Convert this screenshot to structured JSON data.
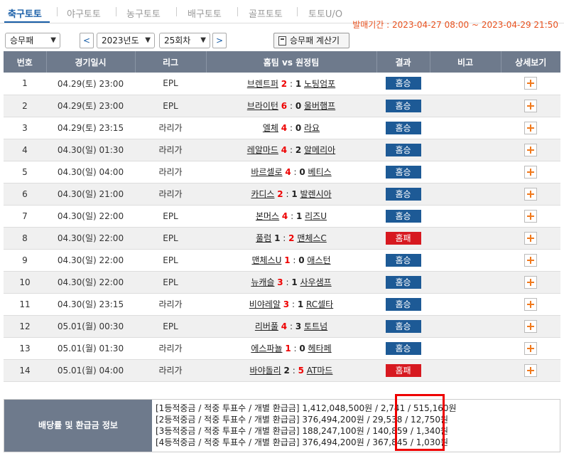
{
  "tabs": [
    "축구토토",
    "야구토토",
    "농구토토",
    "배구토토",
    "골프토토",
    "토토U/O"
  ],
  "sale_period": "발매기간 : 2023-04-27 08:00 ~ 2023-04-29 21:50",
  "controls": {
    "game_type": "승무패",
    "year": "2023년도",
    "round": "25회차",
    "prev": "<",
    "next": ">",
    "calc_label": "승무패 계산기"
  },
  "columns": [
    "번호",
    "경기일시",
    "리그",
    "홈팀 vs 원정팀",
    "결과",
    "비고",
    "상세보기"
  ],
  "rows": [
    {
      "no": "1",
      "date": "04.29(토) 23:00",
      "league": "EPL",
      "home": "브렌트퍼",
      "hs": "2",
      "as": "1",
      "away": "노팅엄포",
      "result": "홈승",
      "rtype": "home"
    },
    {
      "no": "2",
      "date": "04.29(토) 23:00",
      "league": "EPL",
      "home": "브라이턴",
      "hs": "6",
      "as": "0",
      "away": "울버햄프",
      "result": "홈승",
      "rtype": "home"
    },
    {
      "no": "3",
      "date": "04.29(토) 23:15",
      "league": "라리가",
      "home": "엘체",
      "hs": "4",
      "as": "0",
      "away": "라요",
      "result": "홈승",
      "rtype": "home"
    },
    {
      "no": "4",
      "date": "04.30(일) 01:30",
      "league": "라리가",
      "home": "레알마드",
      "hs": "4",
      "as": "2",
      "away": "알메리아",
      "result": "홈승",
      "rtype": "home"
    },
    {
      "no": "5",
      "date": "04.30(일) 04:00",
      "league": "라리가",
      "home": "바르셀로",
      "hs": "4",
      "as": "0",
      "away": "베티스",
      "result": "홈승",
      "rtype": "home"
    },
    {
      "no": "6",
      "date": "04.30(일) 21:00",
      "league": "라리가",
      "home": "카디스",
      "hs": "2",
      "as": "1",
      "away": "발렌시아",
      "result": "홈승",
      "rtype": "home"
    },
    {
      "no": "7",
      "date": "04.30(일) 22:00",
      "league": "EPL",
      "home": "본머스",
      "hs": "4",
      "as": "1",
      "away": "리즈U",
      "result": "홈승",
      "rtype": "home"
    },
    {
      "no": "8",
      "date": "04.30(일) 22:00",
      "league": "EPL",
      "home": "풀럼",
      "hs": "1",
      "as": "2",
      "away": "맨체스C",
      "result": "홈패",
      "rtype": "loss"
    },
    {
      "no": "9",
      "date": "04.30(일) 22:00",
      "league": "EPL",
      "home": "맨체스U",
      "hs": "1",
      "as": "0",
      "away": "애스턴",
      "result": "홈승",
      "rtype": "home"
    },
    {
      "no": "10",
      "date": "04.30(일) 22:00",
      "league": "EPL",
      "home": "뉴캐슬",
      "hs": "3",
      "as": "1",
      "away": "사우샘프",
      "result": "홈승",
      "rtype": "home"
    },
    {
      "no": "11",
      "date": "04.30(일) 23:15",
      "league": "라리가",
      "home": "비야레알",
      "hs": "3",
      "as": "1",
      "away": "RC셀타",
      "result": "홈승",
      "rtype": "home"
    },
    {
      "no": "12",
      "date": "05.01(월) 00:30",
      "league": "EPL",
      "home": "리버풀",
      "hs": "4",
      "as": "3",
      "away": "토트넘",
      "result": "홈승",
      "rtype": "home"
    },
    {
      "no": "13",
      "date": "05.01(월) 01:30",
      "league": "라리가",
      "home": "에스파뇰",
      "hs": "1",
      "as": "0",
      "away": "헤타페",
      "result": "홈승",
      "rtype": "home"
    },
    {
      "no": "14",
      "date": "05.01(월) 04:00",
      "league": "라리가",
      "home": "바야돌리",
      "hs": "2",
      "as": "5",
      "away": "AT마드",
      "result": "홈패",
      "rtype": "loss"
    }
  ],
  "dividend": {
    "header": "배당률 및 환급금 정보",
    "lines": [
      "[1등적중금 / 적중 투표수 / 개별 환급금] 1,412,048,500원 / 2,741 / 515,160원",
      "[2등적중금 / 적중 투표수 / 개별 환급금] 376,494,200원 / 29,538 / 12,750원",
      "[3등적중금 / 적중 투표수 / 개별 환급금] 188,247,100원 / 140,859 / 1,340원",
      "[4등적중금 / 적중 투표수 / 개별 환급금] 376,494,200원 / 367,845 / 1,030원"
    ]
  },
  "colors": {
    "accent": "#1a5fa8",
    "period": "#e8511e",
    "header_bg": "#6e7a8c",
    "home_win": "#1d5a96",
    "home_loss": "#d71920",
    "highlight": "#e00000"
  }
}
